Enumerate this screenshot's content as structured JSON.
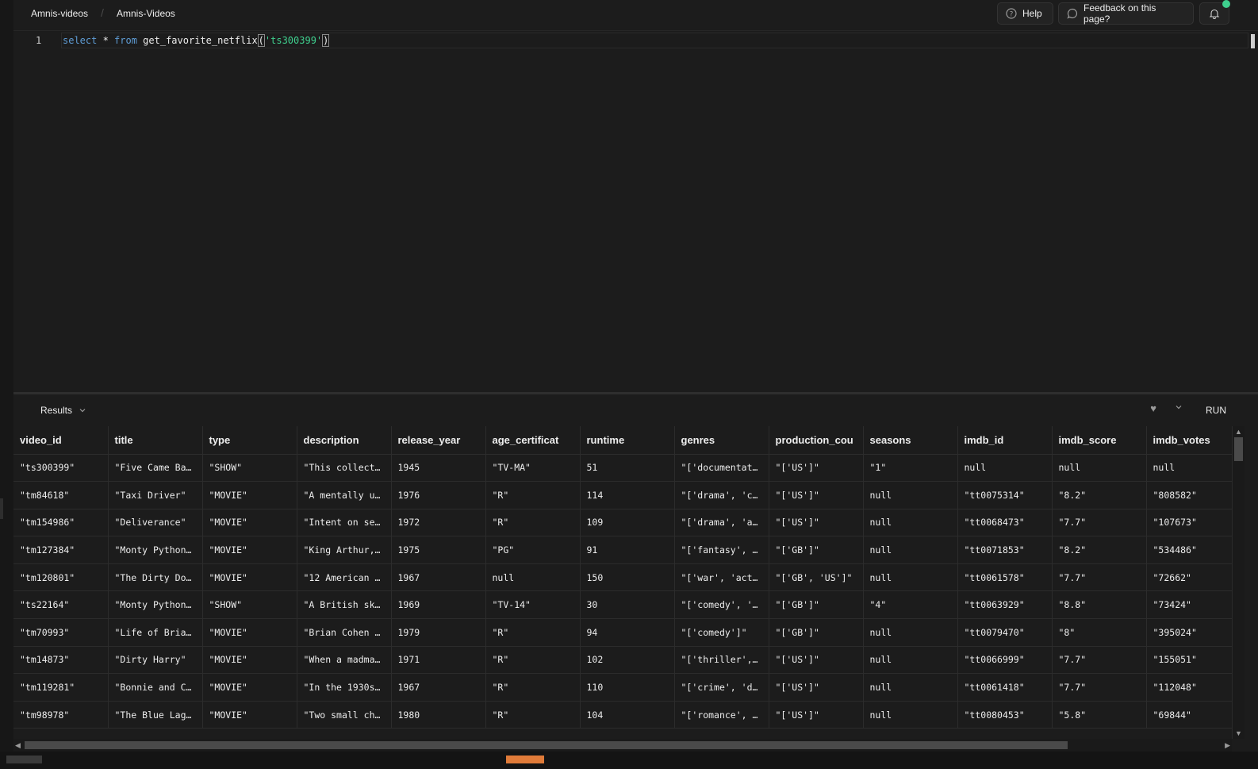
{
  "breadcrumb": {
    "project": "Amnis-videos",
    "separator": "/",
    "database": "Amnis-Videos"
  },
  "toolbar": {
    "help_label": "Help",
    "feedback_label": "Feedback on this page?"
  },
  "editor": {
    "line_number": "1",
    "tokens": [
      "select",
      " * ",
      "from",
      " get_favorite_netflix",
      "(",
      "'ts300399'",
      ")"
    ]
  },
  "results": {
    "label": "Results",
    "run_label": "RUN",
    "columns": [
      "video_id",
      "title",
      "type",
      "description",
      "release_year",
      "age_certificat",
      "runtime",
      "genres",
      "production_cou",
      "seasons",
      "imdb_id",
      "imdb_score",
      "imdb_votes"
    ],
    "rows": [
      [
        "\"ts300399\"",
        "\"Five Came Ba…",
        "\"SHOW\"",
        "\"This collect…",
        "1945",
        "\"TV-MA\"",
        "51",
        "\"['documentat…",
        "\"['US']\"",
        "\"1\"",
        "null",
        "null",
        "null"
      ],
      [
        "\"tm84618\"",
        "\"Taxi Driver\"",
        "\"MOVIE\"",
        "\"A mentally u…",
        "1976",
        "\"R\"",
        "114",
        "\"['drama', 'c…",
        "\"['US']\"",
        "null",
        "\"tt0075314\"",
        "\"8.2\"",
        "\"808582\""
      ],
      [
        "\"tm154986\"",
        "\"Deliverance\"",
        "\"MOVIE\"",
        "\"Intent on se…",
        "1972",
        "\"R\"",
        "109",
        "\"['drama', 'a…",
        "\"['US']\"",
        "null",
        "\"tt0068473\"",
        "\"7.7\"",
        "\"107673\""
      ],
      [
        "\"tm127384\"",
        "\"Monty Python…",
        "\"MOVIE\"",
        "\"King Arthur,…",
        "1975",
        "\"PG\"",
        "91",
        "\"['fantasy', …",
        "\"['GB']\"",
        "null",
        "\"tt0071853\"",
        "\"8.2\"",
        "\"534486\""
      ],
      [
        "\"tm120801\"",
        "\"The Dirty Do…",
        "\"MOVIE\"",
        "\"12 American …",
        "1967",
        "null",
        "150",
        "\"['war', 'act…",
        "\"['GB', 'US']\"",
        "null",
        "\"tt0061578\"",
        "\"7.7\"",
        "\"72662\""
      ],
      [
        "\"ts22164\"",
        "\"Monty Python…",
        "\"SHOW\"",
        "\"A British sk…",
        "1969",
        "\"TV-14\"",
        "30",
        "\"['comedy', '…",
        "\"['GB']\"",
        "\"4\"",
        "\"tt0063929\"",
        "\"8.8\"",
        "\"73424\""
      ],
      [
        "\"tm70993\"",
        "\"Life of Bria…",
        "\"MOVIE\"",
        "\"Brian Cohen …",
        "1979",
        "\"R\"",
        "94",
        "\"['comedy']\"",
        "\"['GB']\"",
        "null",
        "\"tt0079470\"",
        "\"8\"",
        "\"395024\""
      ],
      [
        "\"tm14873\"",
        "\"Dirty Harry\"",
        "\"MOVIE\"",
        "\"When a madma…",
        "1971",
        "\"R\"",
        "102",
        "\"['thriller',…",
        "\"['US']\"",
        "null",
        "\"tt0066999\"",
        "\"7.7\"",
        "\"155051\""
      ],
      [
        "\"tm119281\"",
        "\"Bonnie and C…",
        "\"MOVIE\"",
        "\"In the 1930s…",
        "1967",
        "\"R\"",
        "110",
        "\"['crime', 'd…",
        "\"['US']\"",
        "null",
        "\"tt0061418\"",
        "\"7.7\"",
        "\"112048\""
      ],
      [
        "\"tm98978\"",
        "\"The Blue Lag…",
        "\"MOVIE\"",
        "\"Two small ch…",
        "1980",
        "\"R\"",
        "104",
        "\"['romance', …",
        "\"['US']\"",
        "null",
        "\"tt0080453\"",
        "\"5.8\"",
        "\"69844\""
      ]
    ]
  },
  "colors": {
    "background": "#1c1c1c",
    "keyword": "#5f9dd6",
    "string": "#3fcf8e",
    "notification_dot": "#3ecf8e",
    "taskbar_chip": "#e07b39"
  },
  "icons": [
    "help-icon",
    "feedback-icon",
    "bell-icon",
    "chevron-down-icon",
    "heart-icon"
  ]
}
